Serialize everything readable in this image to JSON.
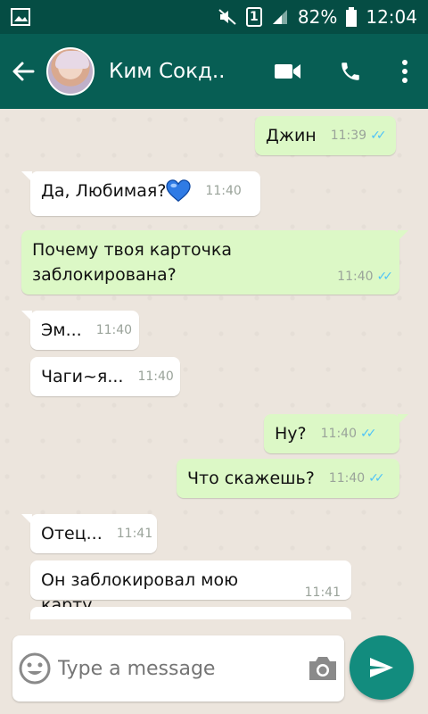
{
  "status_bar": {
    "battery": "82%",
    "time": "12:04",
    "sim": "1"
  },
  "header": {
    "contact_name": "Ким Сокд..",
    "icons": [
      "back-arrow-icon",
      "video-call-icon",
      "phone-icon",
      "more-options-icon"
    ]
  },
  "messages": [
    {
      "direction": "out",
      "text": "Джин",
      "time": "11:39",
      "ticks": "✓✓"
    },
    {
      "direction": "in",
      "text": "Да, Любимая?",
      "emoji": "blue-heart",
      "time": "11:40"
    },
    {
      "direction": "out",
      "text_line1": "Почему твоя карточка",
      "text_line2": "заблокирована?",
      "time": "11:40",
      "ticks": "✓✓"
    },
    {
      "direction": "in",
      "text": "Эм...",
      "time": "11:40"
    },
    {
      "direction": "in",
      "text": "Чаги~я...",
      "time": "11:40"
    },
    {
      "direction": "out",
      "text": "Ну?",
      "time": "11:40",
      "ticks": "✓✓"
    },
    {
      "direction": "out",
      "text": "Что скажешь?",
      "time": "11:40",
      "ticks": "✓✓"
    },
    {
      "direction": "in",
      "text": "Отец...",
      "time": "11:41"
    },
    {
      "direction": "in",
      "text": "Он заблокировал мою карту",
      "time": "11:41"
    }
  ],
  "input": {
    "placeholder": "Type a message"
  },
  "colors": {
    "header": "#075e54",
    "status_bar": "#054d44",
    "outgoing_bubble": "#dcf8c6",
    "incoming_bubble": "#ffffff",
    "send_button": "#128c7e",
    "read_ticks": "#4fc3f7"
  }
}
